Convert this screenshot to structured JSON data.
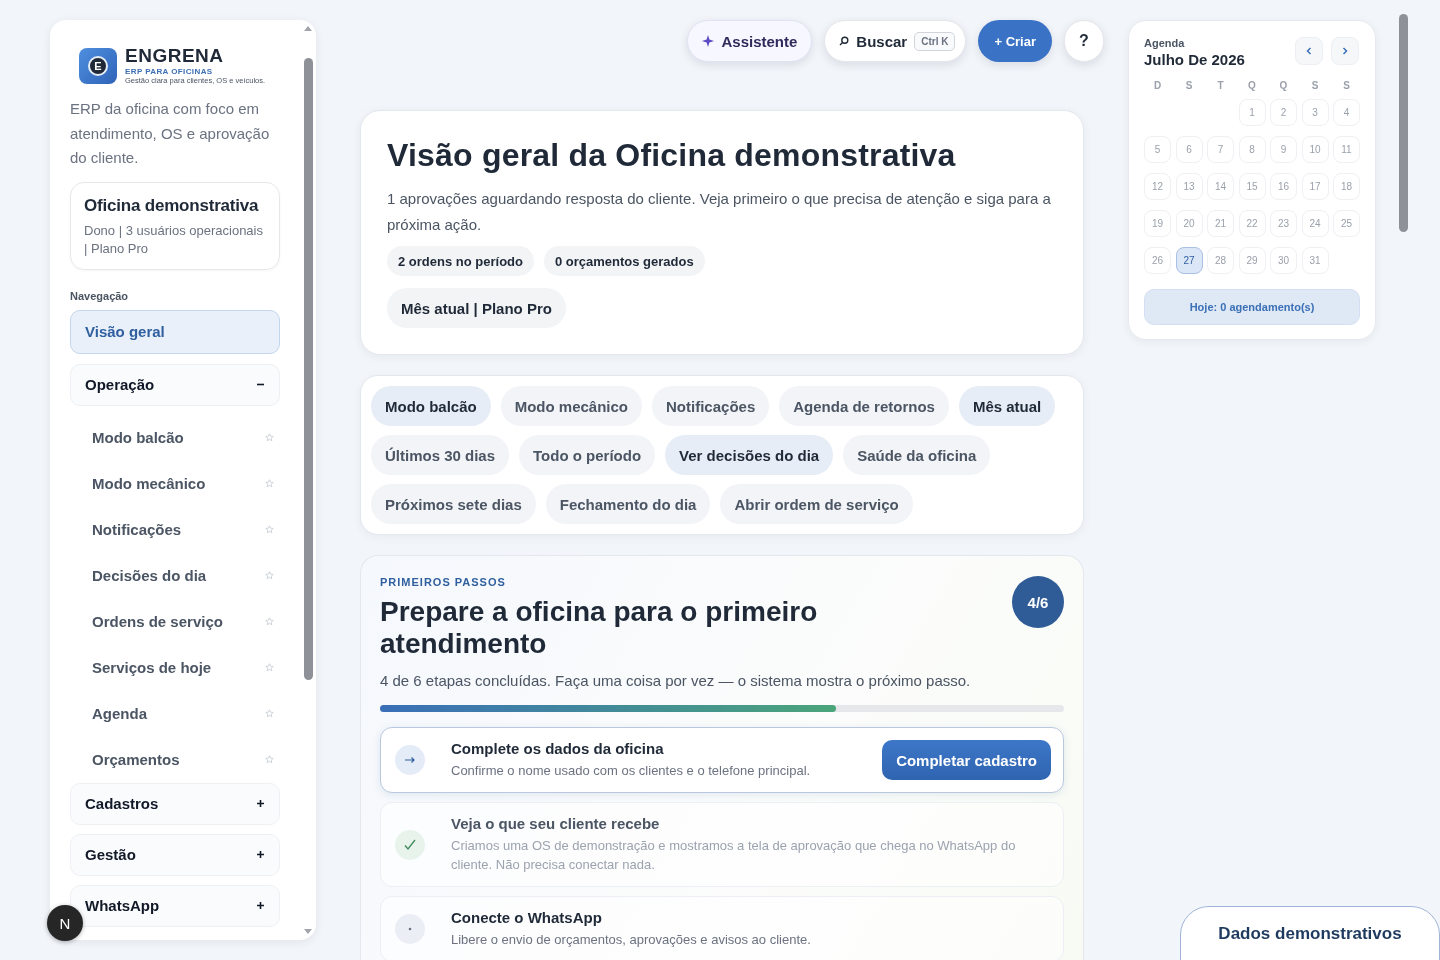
{
  "brand": {
    "mark": "E",
    "name": "ENGRENA",
    "tagline": "ERP PARA OFICINAS",
    "subtitle": "Gestão clara para clientes, OS e veículos."
  },
  "sidebar": {
    "description": "ERP da oficina com foco em atendimento, OS e aprovação do cliente.",
    "workspace": {
      "name": "Oficina demonstrativa",
      "details": "Dono | 3 usuários operacionais | Plano Pro"
    },
    "nav_label": "Navegação",
    "items": [
      {
        "kind": "link",
        "label": "Visão geral",
        "selected": true
      },
      {
        "kind": "group",
        "label": "Operação",
        "expanded": true,
        "children": [
          {
            "label": "Modo balcão"
          },
          {
            "label": "Modo mecânico"
          },
          {
            "label": "Notificações"
          },
          {
            "label": "Decisões do dia"
          },
          {
            "label": "Ordens de serviço"
          },
          {
            "label": "Serviços de hoje"
          },
          {
            "label": "Agenda"
          },
          {
            "label": "Orçamentos"
          }
        ]
      },
      {
        "kind": "group",
        "label": "Cadastros",
        "expanded": false
      },
      {
        "kind": "group",
        "label": "Gestão",
        "expanded": false
      },
      {
        "kind": "group",
        "label": "WhatsApp",
        "expanded": false
      }
    ]
  },
  "toolbar": {
    "assistant": "Assistente",
    "search": {
      "label": "Buscar",
      "shortcut": "Ctrl K"
    },
    "create": "+ Criar",
    "help": "?"
  },
  "hero": {
    "title": "Visão geral da Oficina demonstrativa",
    "text": "1 aprovações aguardando resposta do cliente. Veja primeiro o que precisa de atenção e siga para a próxima ação.",
    "chips": [
      "2 ordens no período",
      "0 orçamentos gerados"
    ],
    "period": "Mês atual | Plano Pro"
  },
  "shortcuts": [
    {
      "label": "Modo balcão",
      "selected": true
    },
    {
      "label": "Modo mecânico",
      "selected": false
    },
    {
      "label": "Notificações",
      "selected": false
    },
    {
      "label": "Agenda de retornos",
      "selected": false
    },
    {
      "label": "Mês atual",
      "selected": true
    },
    {
      "label": "Últimos 30 dias",
      "selected": false
    },
    {
      "label": "Todo o período",
      "selected": false
    },
    {
      "label": "Ver decisões do dia",
      "selected": true
    },
    {
      "label": "Saúde da oficina",
      "selected": false
    },
    {
      "label": "Próximos sete dias",
      "selected": false
    },
    {
      "label": "Fechamento do dia",
      "selected": false
    },
    {
      "label": "Abrir ordem de serviço",
      "selected": false
    }
  ],
  "onboarding": {
    "eyebrow": "PRIMEIROS PASSOS",
    "title": "Prepare a oficina para o primeiro atendimento",
    "badge": "4/6",
    "text": "4 de 6 etapas concluídas. Faça uma coisa por vez — o sistema mostra o próximo passo.",
    "level": 0.666,
    "steps": [
      {
        "kind": "current",
        "title": "Complete os dados da oficina",
        "text": "Confirme o nome usado com os clientes e o telefone principal.",
        "action": "Completar cadastro"
      },
      {
        "kind": "done",
        "title": "Veja o que seu cliente recebe",
        "text": "Criamos uma OS de demonstração e mostramos a tela de aprovação que chega no WhatsApp do cliente. Não precisa conectar nada."
      },
      {
        "kind": "pending",
        "title": "Conecte o WhatsApp",
        "text": "Libere o envio de orçamentos, aprovações e avisos ao cliente."
      }
    ]
  },
  "calendar": {
    "label": "Agenda",
    "month": "Julho De 2026",
    "weekdays": [
      "D",
      "S",
      "T",
      "Q",
      "Q",
      "S",
      "S"
    ],
    "days": [
      {
        "kind": "empty"
      },
      {
        "kind": "empty"
      },
      {
        "kind": "empty"
      },
      {
        "kind": "day",
        "label": "1",
        "selected": false
      },
      {
        "kind": "day",
        "label": "2",
        "selected": false
      },
      {
        "kind": "day",
        "label": "3",
        "selected": false
      },
      {
        "kind": "day",
        "label": "4",
        "selected": false
      },
      {
        "kind": "day",
        "label": "5",
        "selected": false
      },
      {
        "kind": "day",
        "label": "6",
        "selected": false
      },
      {
        "kind": "day",
        "label": "7",
        "selected": false
      },
      {
        "kind": "day",
        "label": "8",
        "selected": false
      },
      {
        "kind": "day",
        "label": "9",
        "selected": false
      },
      {
        "kind": "day",
        "label": "10",
        "selected": false
      },
      {
        "kind": "day",
        "label": "11",
        "selected": false
      },
      {
        "kind": "day",
        "label": "12",
        "selected": false
      },
      {
        "kind": "day",
        "label": "13",
        "selected": false
      },
      {
        "kind": "day",
        "label": "14",
        "selected": false
      },
      {
        "kind": "day",
        "label": "15",
        "selected": false
      },
      {
        "kind": "day",
        "label": "16",
        "selected": false
      },
      {
        "kind": "day",
        "label": "17",
        "selected": false
      },
      {
        "kind": "day",
        "label": "18",
        "selected": false
      },
      {
        "kind": "day",
        "label": "19",
        "selected": false
      },
      {
        "kind": "day",
        "label": "20",
        "selected": false
      },
      {
        "kind": "day",
        "label": "21",
        "selected": false
      },
      {
        "kind": "day",
        "label": "22",
        "selected": false
      },
      {
        "kind": "day",
        "label": "23",
        "selected": false
      },
      {
        "kind": "day",
        "label": "24",
        "selected": false
      },
      {
        "kind": "day",
        "label": "25",
        "selected": false
      },
      {
        "kind": "day",
        "label": "26",
        "selected": false
      },
      {
        "kind": "day",
        "label": "27",
        "selected": true
      },
      {
        "kind": "day",
        "label": "28",
        "selected": false
      },
      {
        "kind": "day",
        "label": "29",
        "selected": false
      },
      {
        "kind": "day",
        "label": "30",
        "selected": false
      },
      {
        "kind": "day",
        "label": "31",
        "selected": false
      }
    ],
    "today": "Hoje: 0 agendamento(s)"
  },
  "avatar": "N",
  "demo_badge": "Dados demonstrativos"
}
